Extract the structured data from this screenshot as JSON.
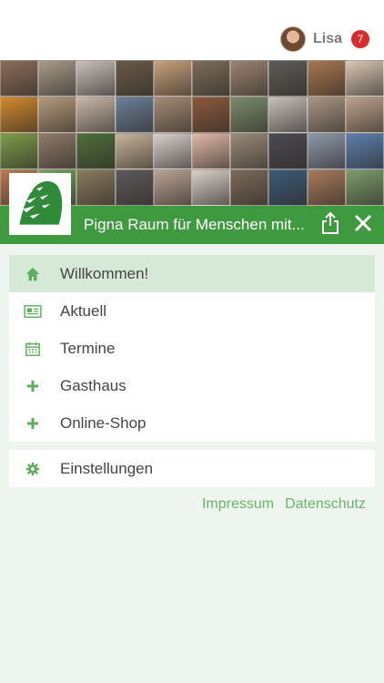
{
  "user": {
    "name": "Lisa",
    "notifications": "7"
  },
  "banner": {
    "tile_colors": [
      "#8c6d5a",
      "#a89b8a",
      "#c8c0b8",
      "#6a5a48",
      "#c9a07b",
      "#7c6d5c",
      "#9a8370",
      "#5d5c56",
      "#a7774f",
      "#d8c7b3",
      "#d28a2e",
      "#b39a7c",
      "#c7b8a8",
      "#6b7f9a",
      "#a58b74",
      "#8b5a3c",
      "#7a8c6c",
      "#c6c0ba",
      "#a89686",
      "#bda28c",
      "#7d9c4a",
      "#8e7a6a",
      "#4e6e3a",
      "#c8b49a",
      "#d8d0cc",
      "#e0b9a8",
      "#9a8a7a",
      "#4a4a52",
      "#8c99aa",
      "#5b7fb0",
      "#b87a52",
      "#6fa45a",
      "#8a7b5e",
      "#5b5a5c",
      "#b9a394",
      "#d8d0c8",
      "#7a6a5a",
      "#3c5a78",
      "#a67b5b",
      "#7c9c6c"
    ]
  },
  "header": {
    "title": "Pigna Raum für Menschen mit..."
  },
  "menu": {
    "items": [
      {
        "label": "Willkommen!",
        "icon": "home-icon"
      },
      {
        "label": "Aktuell",
        "icon": "newspaper-icon"
      },
      {
        "label": "Termine",
        "icon": "calendar-icon"
      },
      {
        "label": "Gasthaus",
        "icon": "plus-icon"
      },
      {
        "label": "Online-Shop",
        "icon": "plus-icon"
      }
    ],
    "settings": {
      "label": "Einstellungen",
      "icon": "gear-icon"
    }
  },
  "footer": {
    "impressum": "Impressum",
    "datenschutz": "Datenschutz"
  },
  "colors": {
    "accent": "#3f9a3f",
    "active_bg": "#d6e9d6",
    "icon": "#5fae5f",
    "badge": "#d82c2c",
    "link": "#6ab46a"
  }
}
